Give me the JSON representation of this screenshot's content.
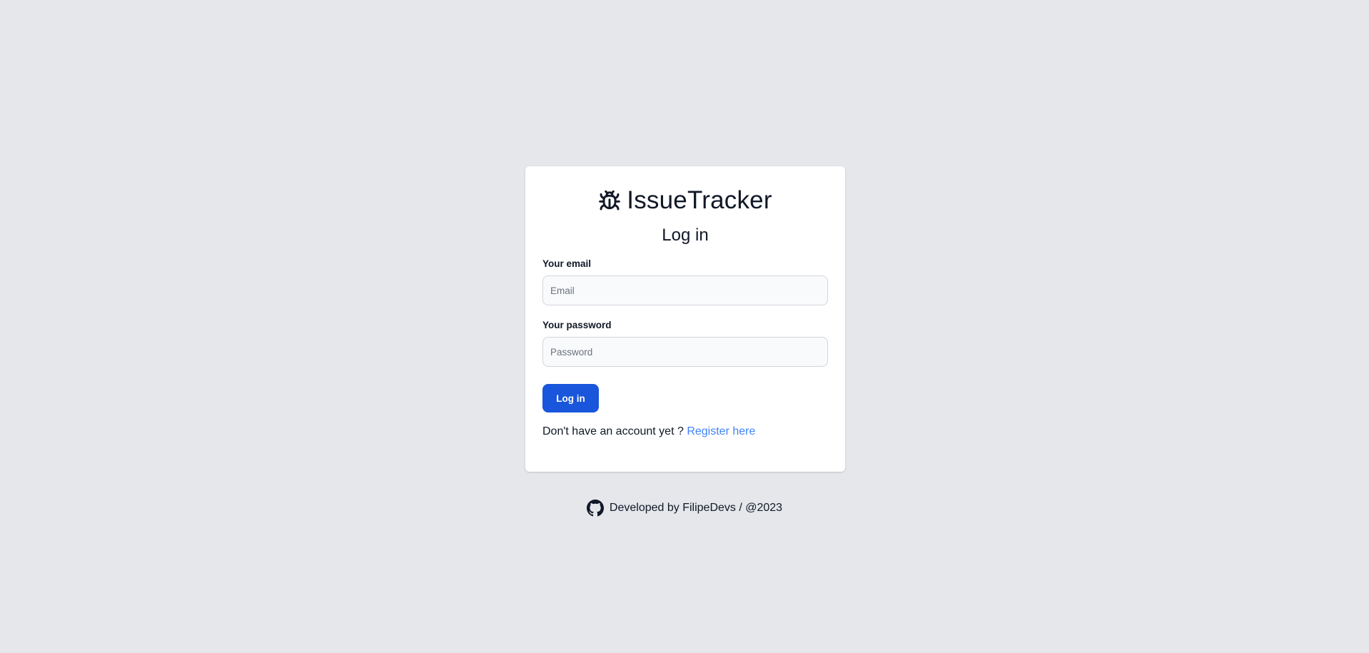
{
  "app": {
    "name": "IssueTracker",
    "icon": "bug-icon"
  },
  "login": {
    "title": "Log in",
    "email_label": "Your email",
    "email_placeholder": "Email",
    "email_value": "",
    "password_label": "Your password",
    "password_placeholder": "Password",
    "password_value": "",
    "submit_label": "Log in",
    "register_prompt": "Don't have an account yet ?",
    "register_link": "Register here"
  },
  "footer": {
    "icon": "github-icon",
    "text": "Developed by FilipeDevs / @2023"
  },
  "colors": {
    "background": "#e5e7eb",
    "card": "#ffffff",
    "primary_button": "#1a56db",
    "link": "#3f83f8",
    "text": "#111827"
  }
}
